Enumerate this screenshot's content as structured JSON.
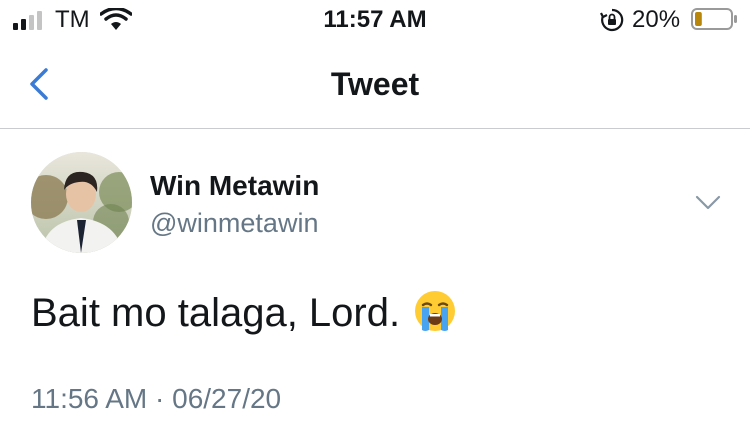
{
  "status_bar": {
    "carrier": "TM",
    "time": "11:57 AM",
    "battery_percent": "20%",
    "battery_level": 0.2,
    "icons": [
      "signal-icon",
      "wifi-icon",
      "rotation-lock-icon",
      "battery-icon"
    ]
  },
  "nav": {
    "title": "Tweet",
    "back_icon": "chevron-left-icon"
  },
  "tweet": {
    "author": {
      "display_name": "Win Metawin",
      "handle": "@winmetawin"
    },
    "text": "Bait mo talaga, Lord.",
    "emoji": "loudly-crying-face",
    "timestamp": "11:56 AM",
    "separator": "·",
    "date": "06/27/20"
  },
  "colors": {
    "accent": "#1da1f2",
    "back_arrow": "#3a7bd5",
    "text_primary": "#14171a",
    "text_secondary": "#657786",
    "divider": "#c8ccd0",
    "battery_fill": "#b8860b"
  }
}
